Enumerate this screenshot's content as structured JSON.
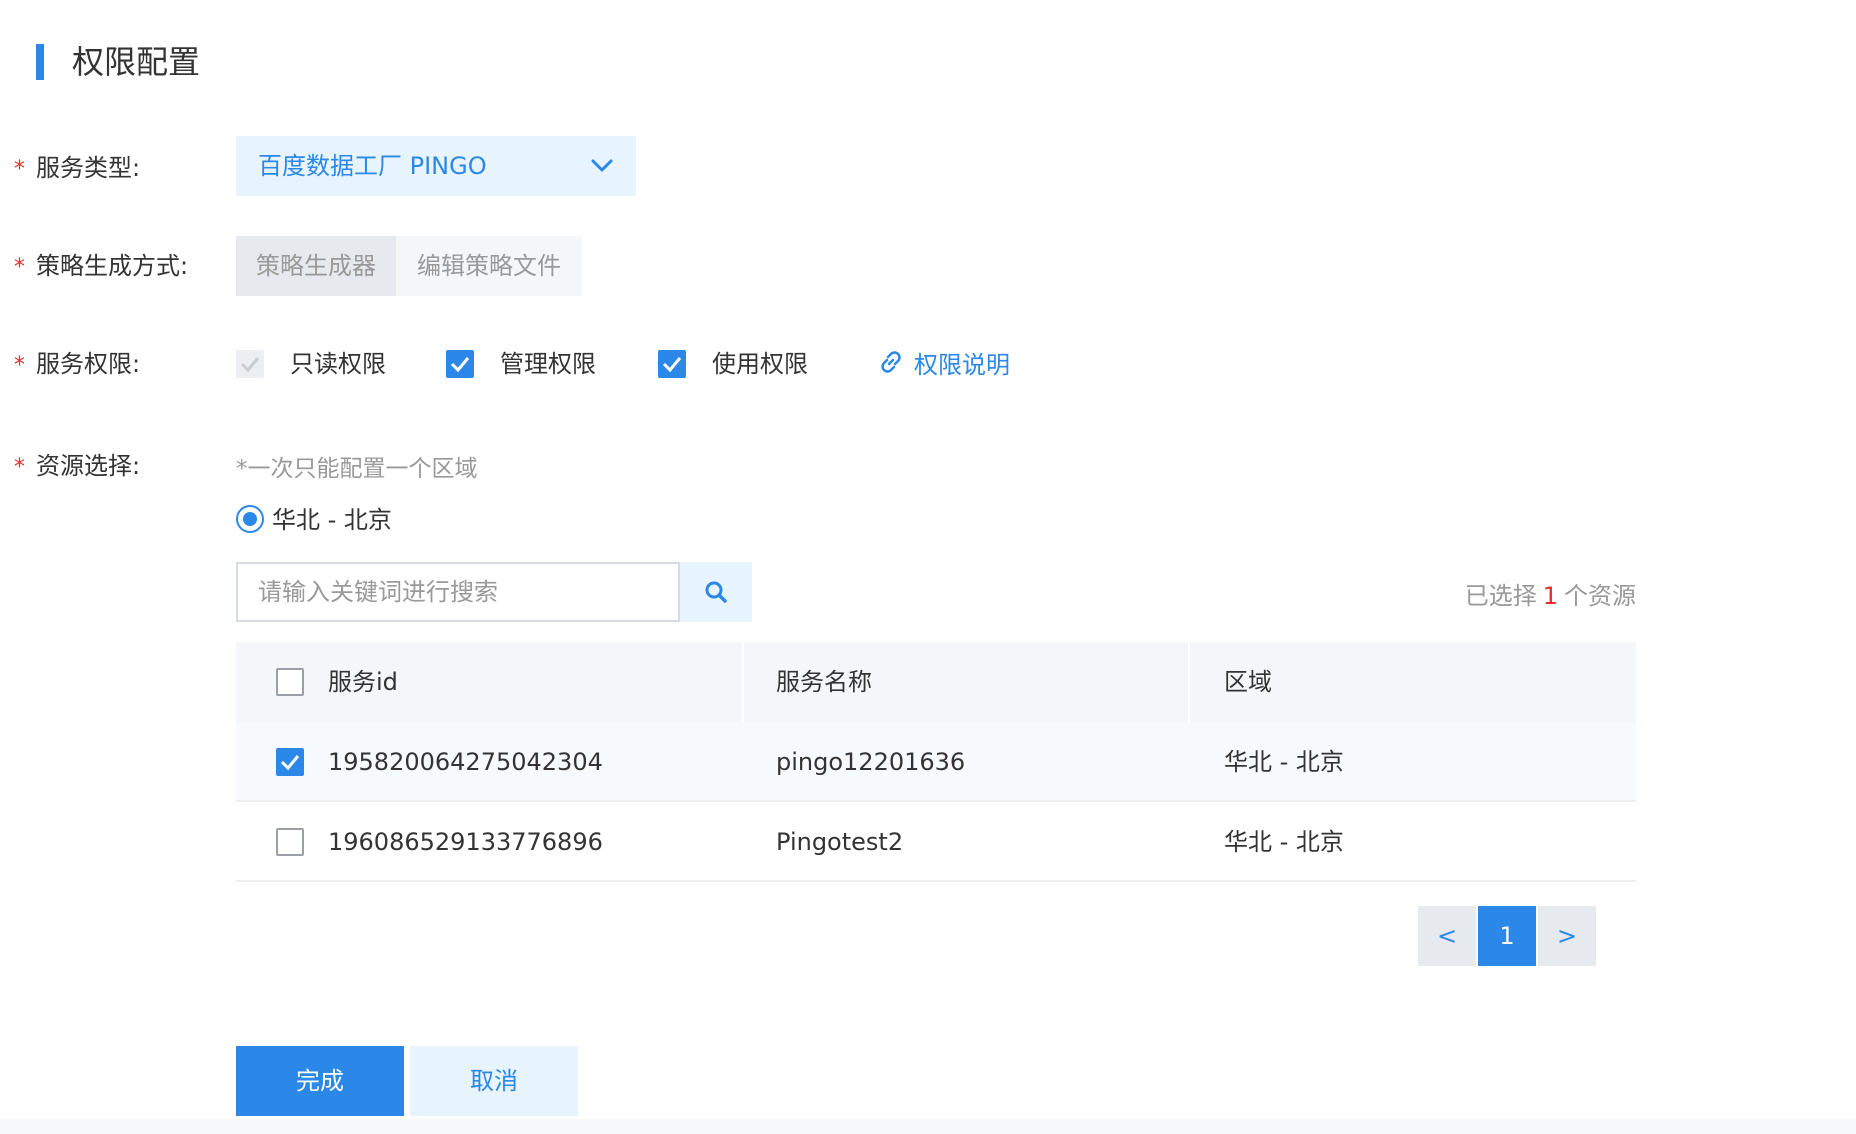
{
  "page_title": "权限配置",
  "colors": {
    "accent": "#2b88e8",
    "required": "#e62e2e",
    "muted_text": "#999999"
  },
  "form": {
    "service_type": {
      "label": "服务类型:",
      "value": "百度数据工厂 PINGO",
      "icon": "chevron-down-icon"
    },
    "strategy": {
      "label": "策略生成方式:",
      "options": [
        "策略生成器",
        "编辑策略文件"
      ],
      "active": "策略生成器"
    },
    "permissions": {
      "label": "服务权限:",
      "items": [
        {
          "label": "只读权限",
          "state": "checked-disabled"
        },
        {
          "label": "管理权限",
          "state": "checked"
        },
        {
          "label": "使用权限",
          "state": "checked"
        }
      ],
      "help_link": "权限说明",
      "help_icon": "link-icon"
    },
    "resources": {
      "label": "资源选择:",
      "hint": "*一次只能配置一个区域",
      "region": "华北 - 北京",
      "search_placeholder": "请输入关键词进行搜索",
      "search_icon": "search-icon",
      "selected_prefix": "已选择",
      "selected_count": "1",
      "selected_suffix": "个资源"
    }
  },
  "table": {
    "columns": [
      "服务id",
      "服务名称",
      "区域"
    ],
    "rows": [
      {
        "id": "195820064275042304",
        "name": "pingo12201636",
        "region": "华北 - 北京",
        "checked": true
      },
      {
        "id": "196086529133776896",
        "name": "Pingotest2",
        "region": "华北 - 北京",
        "checked": false
      }
    ]
  },
  "pagination": {
    "prev": "<",
    "current": "1",
    "next": ">"
  },
  "actions": {
    "confirm": "完成",
    "cancel": "取消"
  }
}
